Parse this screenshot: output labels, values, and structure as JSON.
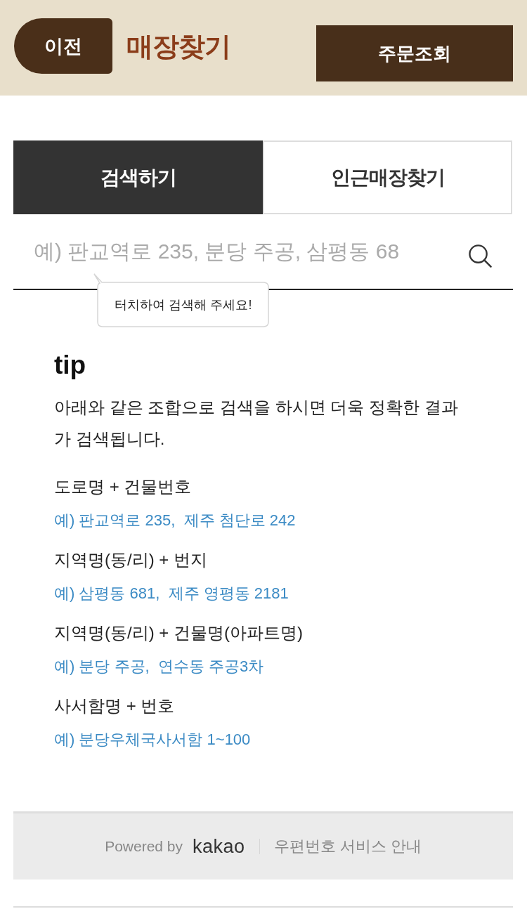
{
  "header": {
    "back_button": "이전",
    "title": "매장찾기",
    "order_button": "주문조회"
  },
  "tabs": [
    {
      "label": "검색하기",
      "selected": true
    },
    {
      "label": "인근매장찾기",
      "selected": false
    }
  ],
  "search": {
    "placeholder": "예) 판교역로 235, 분당 주공, 삼평동 68",
    "tooltip": "터치하여 검색해 주세요!"
  },
  "tip": {
    "title": "tip",
    "description": "아래와 같은 조합으로 검색을 하시면 더욱 정확한 결과가 검색됩니다.",
    "examples": [
      {
        "format": "도로명 + 건물번호",
        "example": "예) 판교역로 235,  제주 첨단로 242"
      },
      {
        "format": "지역명(동/리) + 번지",
        "example": "예) 삼평동 681,  제주 영평동 2181"
      },
      {
        "format": "지역명(동/리) + 건물명(아파트명)",
        "example": "예) 분당 주공,  연수동 주공3차"
      },
      {
        "format": "사서함명 + 번호",
        "example": "예) 분당우체국사서함 1~100"
      }
    ]
  },
  "footer": {
    "powered_by": "Powered by",
    "brand": "kakao",
    "link": "우편번호 서비스 안내"
  }
}
